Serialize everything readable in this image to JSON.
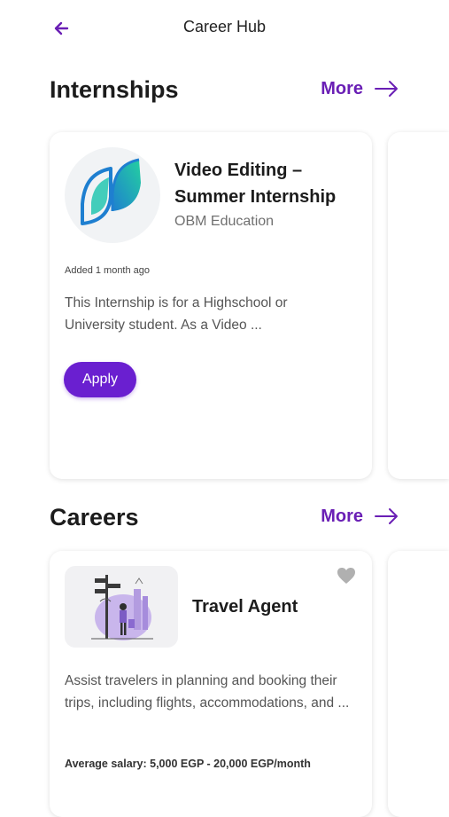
{
  "header": {
    "title": "Career Hub",
    "back_icon": "arrow-left-icon"
  },
  "colors": {
    "accent": "#6a1fb5",
    "button": "#6a1fd0",
    "heart": "#b0b0b0"
  },
  "internships": {
    "title": "Internships",
    "more_label": "More",
    "card": {
      "logo_icon": "obm-education-logo-icon",
      "title": "Video Editing – Summer Internship",
      "company": "OBM Education",
      "added": "Added 1 month ago",
      "description": "This Internship is for a Highschool or University student. As a Video ...",
      "apply_label": "Apply"
    }
  },
  "careers": {
    "title": "Careers",
    "more_label": "More",
    "card": {
      "image_icon": "travel-agent-illustration",
      "title": "Travel Agent",
      "description": "Assist travelers in planning and booking their trips, including flights, accommodations, and ...",
      "salary": "Average salary: 5,000 EGP - 20,000 EGP/month"
    }
  }
}
